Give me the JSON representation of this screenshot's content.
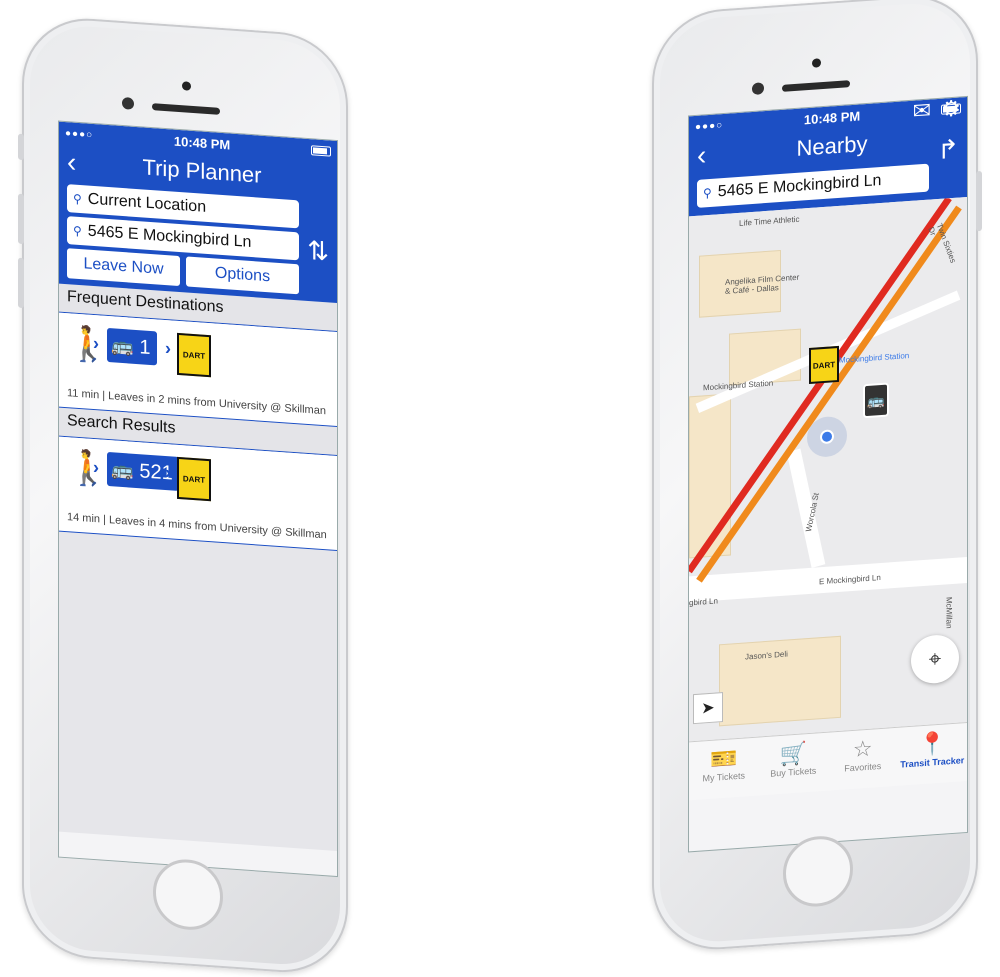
{
  "left": {
    "status_time": "10:48 PM",
    "title": "Trip Planner",
    "from_value": "Current Location",
    "to_value": "5465 E Mockingbird Ln",
    "leave_now_label": "Leave Now",
    "options_label": "Options",
    "frequent_header": "Frequent Destinations",
    "frequent_route": "1",
    "frequent_desc": "11 min | Leaves in 2 mins from University @ Skillman",
    "results_header": "Search Results",
    "result_route": "521",
    "result_desc": "14 min | Leaves in 4 mins from University @ Skillman",
    "dart_label": "DART"
  },
  "right": {
    "status_time": "10:48 PM",
    "title": "Nearby",
    "search_value": "5465 E Mockingbird Ln",
    "map_labels": {
      "lifetime": "Life Time Athletic",
      "angelika": "Angelika Film Center & Café - Dallas",
      "mockingbird_station": "Mockingbird Station",
      "mockingbird_station_blue": "Mockingbird Station",
      "worcola": "Worcola St",
      "mockingbird_ln": "E Mockingbird Ln",
      "mockingbird_ln_left": "gbird Ln",
      "jasons": "Jason's Deli",
      "mcmillan": "McMillan",
      "twin_sixties": "Twin Sixties Dr"
    },
    "dart_label": "DART",
    "tabs": [
      {
        "label": "My Tickets",
        "icon": "ticket-icon"
      },
      {
        "label": "Buy Tickets",
        "icon": "cart-icon"
      },
      {
        "label": "Favorites",
        "icon": "star-icon"
      },
      {
        "label": "Transit Tracker",
        "icon": "map-pin-icon"
      }
    ]
  },
  "colors": {
    "brand_blue": "#1c4fc4",
    "dart_yellow": "#f7d417",
    "red_line": "#e02a20",
    "orange_line": "#f08a1c"
  }
}
